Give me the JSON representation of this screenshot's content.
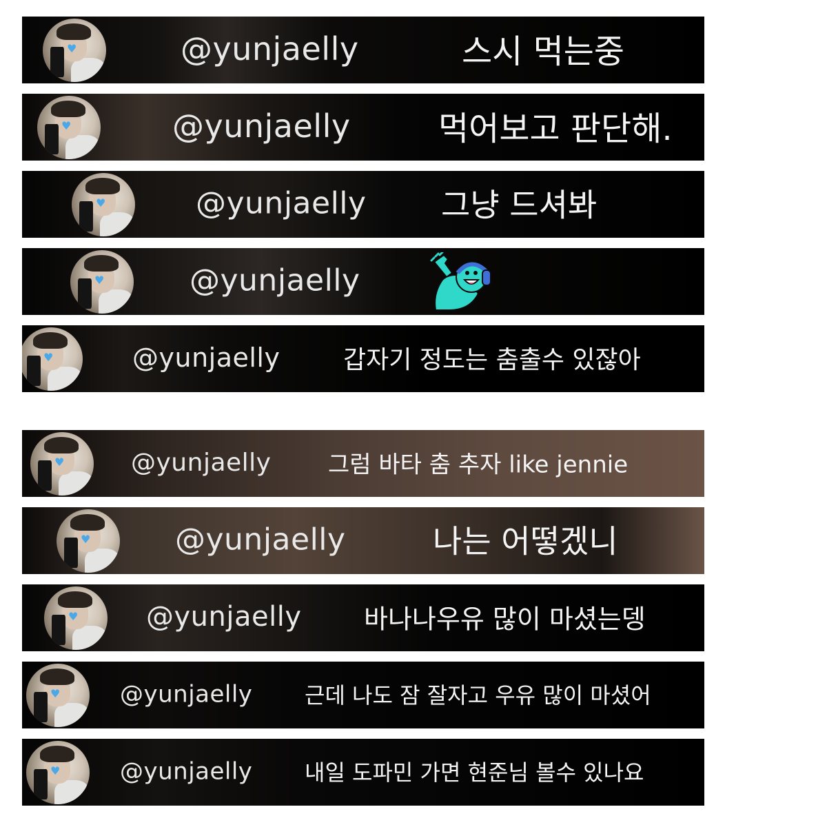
{
  "colors": {
    "row_background": "#050505",
    "text": "#f4f4f4",
    "avatar_heart": "#4aa8e8",
    "sticker_teal": "#2fd8c8",
    "sticker_blue": "#3f6fd8"
  },
  "comments": [
    {
      "handle": "@yunjaelly",
      "message": "스시 먹는중"
    },
    {
      "handle": "@yunjaelly",
      "message": "먹어보고 판단해."
    },
    {
      "handle": "@yunjaelly",
      "message": "그냥 드셔봐"
    },
    {
      "handle": "@yunjaelly",
      "message": "",
      "sticker": "waving-character-with-headphones"
    },
    {
      "handle": "@yunjaelly",
      "message": "갑자기 정도는 춤출수 있잖아"
    },
    {
      "handle": "@yunjaelly",
      "message": "그럼 바타 춤 추자 like jennie"
    },
    {
      "handle": "@yunjaelly",
      "message": "나는 어떻겠니"
    },
    {
      "handle": "@yunjaelly",
      "message": "바나나우유 많이 마셨는뎅"
    },
    {
      "handle": "@yunjaelly",
      "message": "근데 나도 잠 잘자고 우유 많이 마셨어"
    },
    {
      "handle": "@yunjaelly",
      "message": "내일 도파민 가면 현준님 볼수 있나요"
    }
  ]
}
